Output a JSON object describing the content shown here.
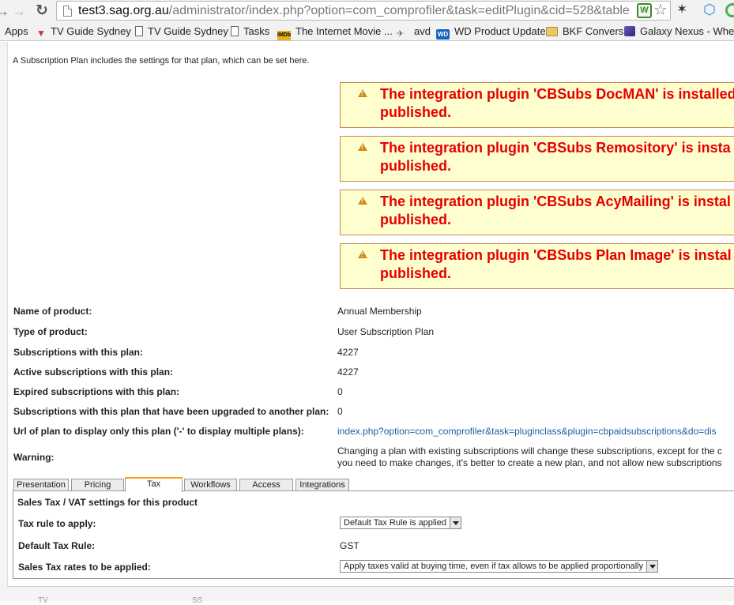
{
  "browser": {
    "url_host": "test3.sag.org.au",
    "url_path": "/administrator/index.php?option=com_comprofiler&task=editPlugin&cid=528&table",
    "bookmarks": [
      {
        "label": "Apps",
        "icon": "apps-icon"
      },
      {
        "label": "TV Guide Sydney",
        "icon": "tv-icon"
      },
      {
        "label": "TV Guide Sydney",
        "icon": "page-icon"
      },
      {
        "label": "Tasks",
        "icon": "page-icon"
      },
      {
        "label": "The Internet Movie ...",
        "icon": "imdb-icon"
      },
      {
        "label": "avd",
        "icon": "avd-icon"
      },
      {
        "label": "WD Product Update",
        "icon": "wd-icon"
      },
      {
        "label": "BKF Convers",
        "icon": "folder-icon"
      },
      {
        "label": "Galaxy Nexus - Wher...",
        "icon": "galaxy-icon"
      }
    ]
  },
  "page": {
    "intro": "A Subscription Plan includes the settings for that plan, which can be set here.",
    "alerts": [
      {
        "line1": "The integration plugin 'CBSubs DocMAN' is installed",
        "line2": "published."
      },
      {
        "line1": "The integration plugin 'CBSubs Remository' is insta",
        "line2": "published."
      },
      {
        "line1": "The integration plugin 'CBSubs AcyMailing' is instal",
        "line2": "published."
      },
      {
        "line1": "The integration plugin 'CBSubs Plan Image' is instal",
        "line2": "published."
      }
    ],
    "rows": [
      {
        "label": "Name of product:",
        "value": "Annual Membership"
      },
      {
        "label": "Type of product:",
        "value": "User Subscription Plan"
      },
      {
        "label": "Subscriptions with this plan:",
        "value": "4227"
      },
      {
        "label": "Active subscriptions with this plan:",
        "value": "4227"
      },
      {
        "label": "Expired subscriptions with this plan:",
        "value": "0"
      },
      {
        "label": "Subscriptions with this plan that have been upgraded to another plan:",
        "value": "0"
      },
      {
        "label": "Url of plan to display only this plan ('-' to display multiple plans):",
        "value": "index.php?option=com_comprofiler&task=pluginclass&plugin=cbpaidsubscriptions&do=dis"
      }
    ],
    "warning": {
      "label": "Warning:",
      "line1": "Changing a plan with existing subscriptions will change these subscriptions, except for the c",
      "line2": "you need to make changes, it's better to create a new plan, and not allow new subscriptions"
    },
    "tabs": [
      {
        "label": "Presentation",
        "active": false
      },
      {
        "label": "Pricing",
        "active": false
      },
      {
        "label": "Tax",
        "active": true
      },
      {
        "label": "Workflows",
        "active": false
      },
      {
        "label": "Access",
        "active": false
      },
      {
        "label": "Integrations",
        "active": false
      }
    ],
    "tax_panel": {
      "heading": "Sales Tax / VAT settings for this product",
      "tax_rule_label": "Tax rule to apply:",
      "tax_rule_value": "Default Tax Rule is applied",
      "default_rule_label": "Default Tax Rule:",
      "default_rule_value": "GST",
      "rates_label": "Sales Tax rates to be applied:",
      "rates_value": "Apply taxes valid at buying time, even if tax allows to be applied proportionally"
    },
    "footer": [
      "TV",
      "SS"
    ]
  },
  "colors": {
    "alert_bg": "#fefecf",
    "alert_border": "#c98a4d",
    "alert_text": "#e60000",
    "link": "#1a5fa8",
    "active_tab_accent": "#f3a21a"
  }
}
